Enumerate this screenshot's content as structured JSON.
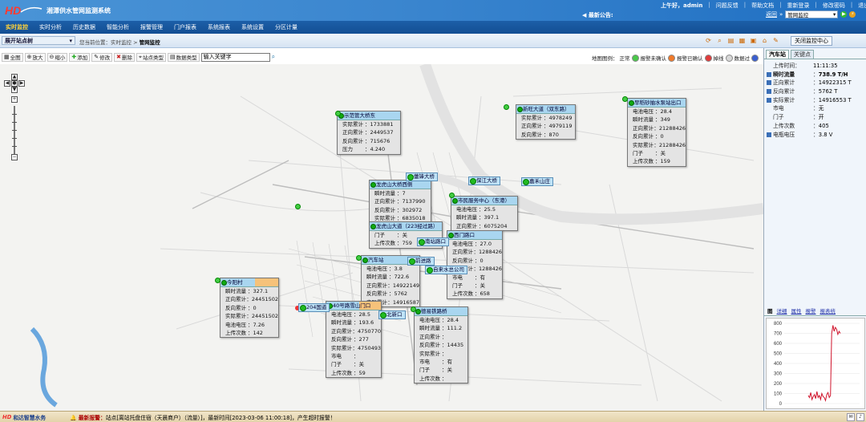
{
  "header": {
    "app_title": "湘潭供水管网监测系统",
    "notice_label": "最新公告:",
    "greeting": "上午好，admin",
    "links": [
      "问题反馈",
      "帮助文档",
      "重新登录",
      "修改密码",
      "退出系统"
    ],
    "return_link": "返回",
    "system_select": "管网监控"
  },
  "nav": {
    "items": [
      "实时监控",
      "实时分析",
      "历史数据",
      "智能分析",
      "报警管理",
      "门户报表",
      "系统报表",
      "系统设置",
      "分区计量"
    ],
    "active": 0
  },
  "toolbar2": {
    "station_select": "展开站点树",
    "crumb_prefix": "您当前位置：实时监控 >",
    "crumb_current": "管网监控",
    "center_button": "关闭监控中心"
  },
  "map_tools": {
    "buttons": [
      "全图",
      "放大",
      "缩小",
      "添加",
      "修改",
      "删除",
      "站点类型",
      "数据类型"
    ],
    "keyword": "输入关键字",
    "legend_label": "地图图例：",
    "legend": [
      {
        "label": "正常",
        "color": "#4bc84b"
      },
      {
        "label": "报警未确认",
        "color": "#f07a2a"
      },
      {
        "label": "报警已确认",
        "color": "#e03c3c"
      },
      {
        "label": "掉线",
        "color": "#d8d8d8"
      },
      {
        "label": "数据过",
        "color": "#3a5fd0"
      }
    ]
  },
  "cards": [
    {
      "title": "示范管大桥东",
      "rows": [
        [
          "实际累计",
          "1733881"
        ],
        [
          "正向累计",
          "2449537"
        ],
        [
          "反向累计",
          "715676"
        ],
        [
          "压力",
          "4.240"
        ]
      ]
    },
    {
      "title": "新旺大道（双东路）",
      "rows": [
        [
          "实际累计",
          "4978249"
        ],
        [
          "正向累计",
          "4979119"
        ],
        [
          "反向累计",
          "870"
        ]
      ]
    },
    {
      "title": "早稻砂抽水泵站出口",
      "rows": [
        [
          "电池电压",
          "28.4"
        ],
        [
          "瞬时流量",
          "349"
        ],
        [
          "正向累计",
          "21288426"
        ],
        [
          "反向累计",
          "0"
        ],
        [
          "实际累计",
          "21288426"
        ],
        [
          "门子",
          "关"
        ],
        [
          "上传次数",
          "159"
        ]
      ]
    },
    {
      "title": "龙虎山大桥西侧",
      "rows": [
        [
          "瞬时流量",
          "7"
        ],
        [
          "正向累计",
          "7137990"
        ],
        [
          "反向累计",
          "302972"
        ],
        [
          "实际累计",
          "6835018"
        ]
      ]
    },
    {
      "title": "市民服务中心（东港）",
      "rows": [
        [
          "电池电压",
          "25.5"
        ],
        [
          "瞬时流量",
          "397.1"
        ],
        [
          "正向累计",
          "6075204"
        ]
      ]
    },
    {
      "title": "龙虎山大道（223经过路）",
      "rows": [
        [
          "门子",
          "关"
        ],
        [
          "上传次数",
          "759"
        ]
      ]
    },
    {
      "title": "西门路口",
      "rows": [
        [
          "电池电压",
          "27.0"
        ],
        [
          "正向累计",
          "1288426"
        ],
        [
          "反向累计",
          "0"
        ],
        [
          "实际累计",
          "1288426"
        ],
        [
          "市电",
          "有"
        ],
        [
          "门子",
          "关"
        ],
        [
          "上传次数",
          "658"
        ]
      ]
    },
    {
      "title": "汽车站",
      "rows": [
        [
          "电池电压",
          "3.8"
        ],
        [
          "瞬时流量",
          "722.6"
        ],
        [
          "正向累计",
          "14922149"
        ],
        [
          "反向累计",
          "5762"
        ],
        [
          "实际累计",
          "14916587"
        ]
      ]
    },
    {
      "title": "今阳村",
      "rows": [
        [
          "瞬时流量",
          "327.1"
        ],
        [
          "正向累计",
          "24451502"
        ],
        [
          "反向累计",
          "0"
        ],
        [
          "实际累计",
          "24451502"
        ],
        [
          "电池电压",
          "7.26"
        ],
        [
          "上传次数",
          "142"
        ]
      ]
    },
    {
      "title": "40号路雪山门口",
      "rows": [
        [
          "电池电压",
          "28.5"
        ],
        [
          "瞬时流量",
          "193.6"
        ],
        [
          "正向累计",
          "4750770"
        ],
        [
          "反向累计",
          "277"
        ],
        [
          "实际累计",
          "4750493"
        ],
        [
          "市电",
          ""
        ],
        [
          "门子",
          "关"
        ],
        [
          "上传次数",
          "59"
        ]
      ]
    },
    {
      "title": "德易铁路桥",
      "rows": [
        [
          "电池电压",
          "28.4"
        ],
        [
          "瞬时流量",
          "111.2"
        ],
        [
          "正向累计",
          ""
        ],
        [
          "反向累计",
          "14435"
        ],
        [
          "实际累计",
          ""
        ],
        [
          "市电",
          "有"
        ],
        [
          "门子",
          "关"
        ],
        [
          "上传次数",
          ""
        ]
      ]
    }
  ],
  "map_labels": [
    "蕾锋大桥",
    "保江大桥",
    "嘉禾山庄",
    "前进路",
    "自来水总公司",
    "新安路",
    "北新口",
    "204国道",
    "南站路口",
    "自来水管理层"
  ],
  "right_panel": {
    "tabs": [
      "汽车站",
      "关键点"
    ],
    "rows": [
      {
        "k": "上传时间：",
        "v": "11:11:35",
        "bullet": false
      },
      {
        "k": "瞬时流量",
        "v": "738.9 T/H",
        "bullet": true,
        "bold": true
      },
      {
        "k": "正向累计",
        "v": "14922315 T",
        "bullet": true
      },
      {
        "k": "反向累计",
        "v": "5762 T",
        "bullet": true
      },
      {
        "k": "实际累计",
        "v": "14916553 T",
        "bullet": true
      },
      {
        "k": "市电",
        "v": "无",
        "bullet": false
      },
      {
        "k": "门子",
        "v": "开",
        "bullet": false
      },
      {
        "k": "上传次数",
        "v": "405",
        "bullet": false
      },
      {
        "k": "电瓶电压",
        "v": "3.8 V",
        "bullet": true
      }
    ],
    "bottom_tabs": [
      "图",
      "详细",
      "属性",
      "报警",
      "报表统"
    ]
  },
  "chart_data": {
    "type": "line",
    "title": "",
    "xlabel": "",
    "ylabel": "",
    "ylim": [
      0,
      800
    ],
    "yticks": [
      0,
      100,
      200,
      300,
      400,
      500,
      600,
      700,
      800
    ],
    "series": [
      {
        "values": [
          80,
          60,
          110,
          40,
          70,
          90,
          50,
          120,
          60,
          80,
          40,
          100,
          70,
          60,
          30,
          90,
          110,
          60,
          80,
          700,
          780,
          720,
          760,
          740,
          690,
          720,
          700
        ]
      }
    ]
  },
  "status": {
    "brand": "和达智慧水务",
    "alarm_label": "最新报警：",
    "alarm_text": "站点[离站托盘住宿（天晨商户）（流量）]，最新时间[2023-03-06 11:00:18]，产生超时报警！"
  }
}
